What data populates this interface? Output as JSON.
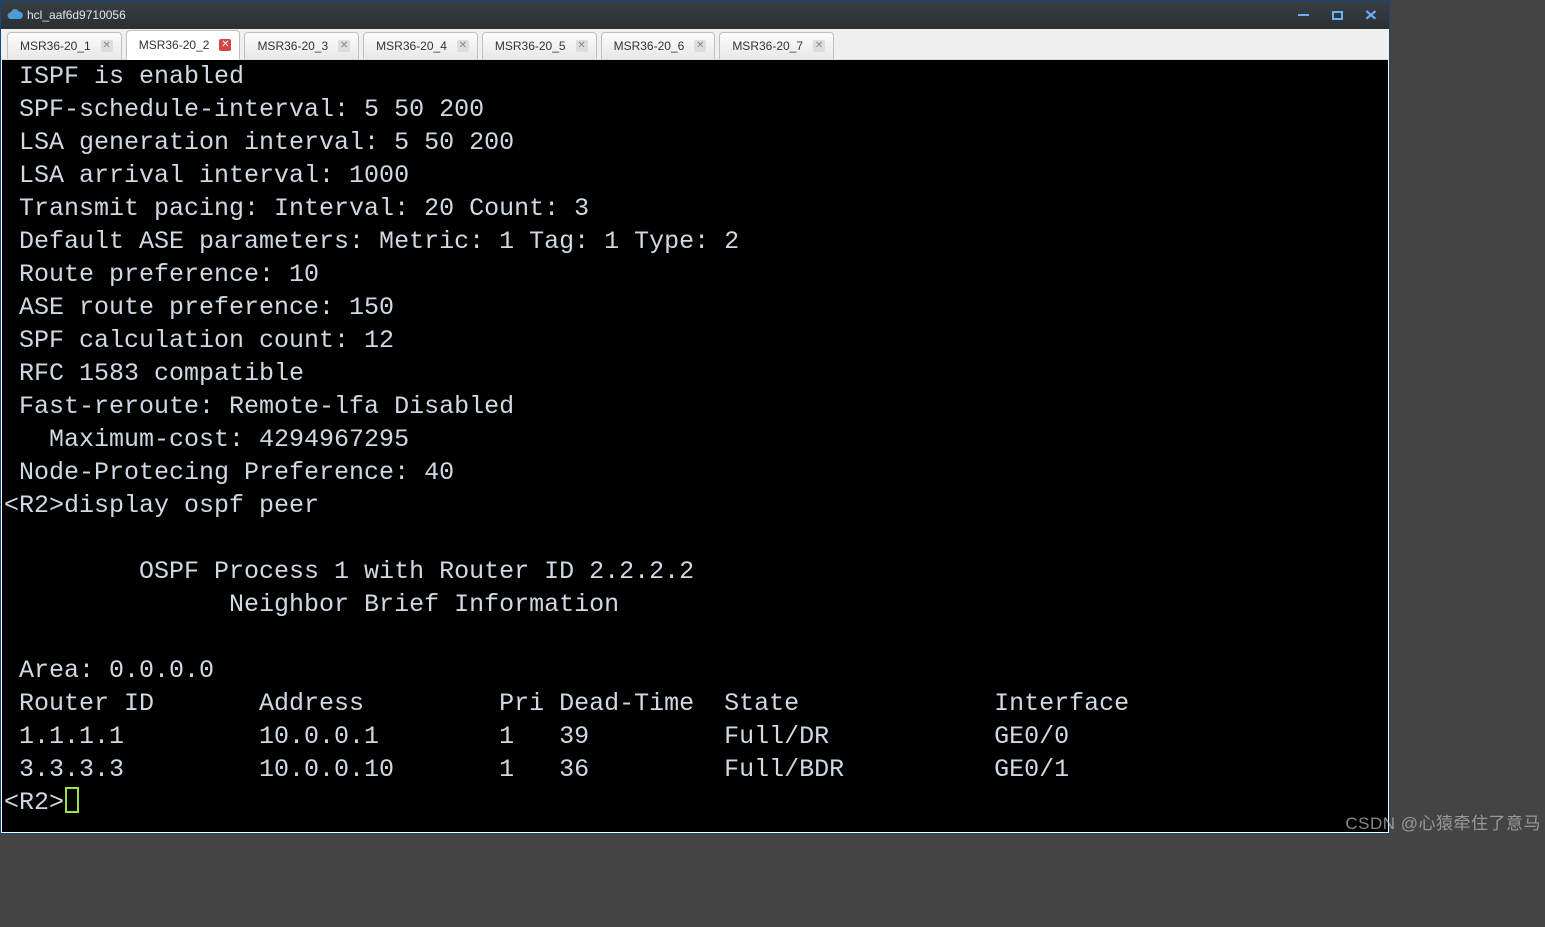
{
  "window": {
    "title": "hcl_aaf6d9710056"
  },
  "tabs": [
    {
      "label": "MSR36-20_1",
      "active": false
    },
    {
      "label": "MSR36-20_2",
      "active": true
    },
    {
      "label": "MSR36-20_3",
      "active": false
    },
    {
      "label": "MSR36-20_4",
      "active": false
    },
    {
      "label": "MSR36-20_5",
      "active": false
    },
    {
      "label": "MSR36-20_6",
      "active": false
    },
    {
      "label": "MSR36-20_7",
      "active": false
    }
  ],
  "terminal": {
    "lines": [
      " ISPF is enabled",
      " SPF-schedule-interval: 5 50 200",
      " LSA generation interval: 5 50 200",
      " LSA arrival interval: 1000",
      " Transmit pacing: Interval: 20 Count: 3",
      " Default ASE parameters: Metric: 1 Tag: 1 Type: 2",
      " Route preference: 10",
      " ASE route preference: 150",
      " SPF calculation count: 12",
      " RFC 1583 compatible",
      " Fast-reroute: Remote-lfa Disabled",
      "   Maximum-cost: 4294967295",
      " Node-Protecing Preference: 40",
      "<R2>display ospf peer",
      "",
      "         OSPF Process 1 with Router ID 2.2.2.2",
      "               Neighbor Brief Information",
      "",
      " Area: 0.0.0.0",
      " Router ID       Address         Pri Dead-Time  State             Interface",
      " 1.1.1.1         10.0.0.1        1   39         Full/DR           GE0/0",
      " 3.3.3.3         10.0.0.10       1   36         Full/BDR          GE0/1"
    ],
    "prompt": "<R2>"
  },
  "ospf_peers": {
    "process_id": 1,
    "router_id": "2.2.2.2",
    "area": "0.0.0.0",
    "columns": [
      "Router ID",
      "Address",
      "Pri",
      "Dead-Time",
      "State",
      "Interface"
    ],
    "rows": [
      {
        "router_id": "1.1.1.1",
        "address": "10.0.0.1",
        "pri": 1,
        "dead_time": 39,
        "state": "Full/DR",
        "interface": "GE0/0"
      },
      {
        "router_id": "3.3.3.3",
        "address": "10.0.0.10",
        "pri": 1,
        "dead_time": 36,
        "state": "Full/BDR",
        "interface": "GE0/1"
      }
    ]
  },
  "watermark": "CSDN @心猿牵住了意马"
}
